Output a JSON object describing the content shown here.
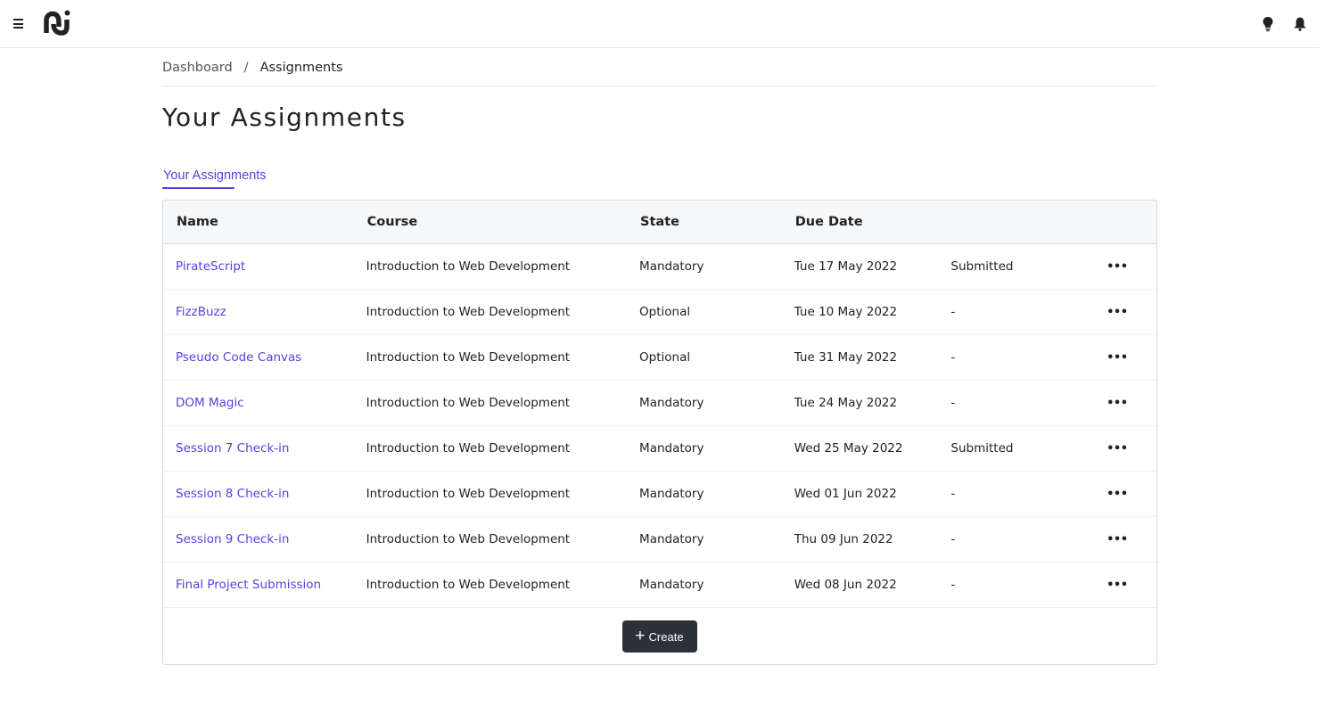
{
  "topbar": {
    "menu_icon": "hamburger-menu-icon",
    "logo_icon": "app-logo-icon",
    "actions": [
      {
        "icon": "lightbulb-icon"
      },
      {
        "icon": "bell-icon"
      }
    ]
  },
  "breadcrumb": {
    "items": [
      "Dashboard",
      "Assignments"
    ],
    "separator": "/"
  },
  "page": {
    "title": "Your Assignments"
  },
  "tabs": [
    {
      "label": "Your Assignments",
      "active": true
    }
  ],
  "table": {
    "columns": [
      "Name",
      "Course",
      "State",
      "Due Date",
      "",
      ""
    ],
    "rows": [
      {
        "name": "PirateScript",
        "course": "Introduction to Web Development",
        "state": "Mandatory",
        "due": "Tue 17 May 2022",
        "status": "Submitted",
        "actions": "•••"
      },
      {
        "name": "FizzBuzz",
        "course": "Introduction to Web Development",
        "state": "Optional",
        "due": "Tue 10 May 2022",
        "status": "-",
        "actions": "•••"
      },
      {
        "name": "Pseudo Code Canvas",
        "course": "Introduction to Web Development",
        "state": "Optional",
        "due": "Tue 31 May 2022",
        "status": "-",
        "actions": "•••"
      },
      {
        "name": "DOM Magic",
        "course": "Introduction to Web Development",
        "state": "Mandatory",
        "due": "Tue 24 May 2022",
        "status": "-",
        "actions": "•••"
      },
      {
        "name": "Session 7 Check-in",
        "course": "Introduction to Web Development",
        "state": "Mandatory",
        "due": "Wed 25 May 2022",
        "status": "Submitted",
        "actions": "•••"
      },
      {
        "name": "Session 8 Check-in",
        "course": "Introduction to Web Development",
        "state": "Mandatory",
        "due": "Wed 01 Jun 2022",
        "status": "-",
        "actions": "•••"
      },
      {
        "name": "Session 9 Check-in",
        "course": "Introduction to Web Development",
        "state": "Mandatory",
        "due": "Thu 09 Jun 2022",
        "status": "-",
        "actions": "•••"
      },
      {
        "name": "Final Project Submission",
        "course": "Introduction to Web Development",
        "state": "Mandatory",
        "due": "Wed 08 Jun 2022",
        "status": "-",
        "actions": "•••"
      }
    ]
  },
  "footer": {
    "create_label": "Create",
    "create_icon": "+"
  },
  "colors": {
    "accent": "#5b3fe0",
    "button_dark": "#2c323a",
    "header_bg": "#f6f7f9",
    "border": "#d6d9de"
  }
}
